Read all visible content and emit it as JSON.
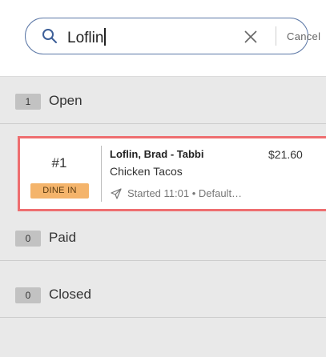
{
  "search": {
    "query": "Loflin",
    "cancel_label": "Cancel"
  },
  "sections": {
    "open": {
      "count": "1",
      "label": "Open"
    },
    "paid": {
      "count": "0",
      "label": "Paid"
    },
    "closed": {
      "count": "0",
      "label": "Closed"
    }
  },
  "order": {
    "number": "#1",
    "type": "DINE IN",
    "customer": "Loflin, Brad - Tabbi",
    "item": "Chicken Tacos",
    "price": "$21.60",
    "status": "Started 11:01 • Default…"
  },
  "colors": {
    "highlight": "#ee6e70",
    "dine_in_badge": "#f4b46b",
    "search_border": "#5b77a6"
  },
  "icons": {
    "search": "search-icon",
    "clear": "close-icon",
    "sent": "send-icon"
  }
}
